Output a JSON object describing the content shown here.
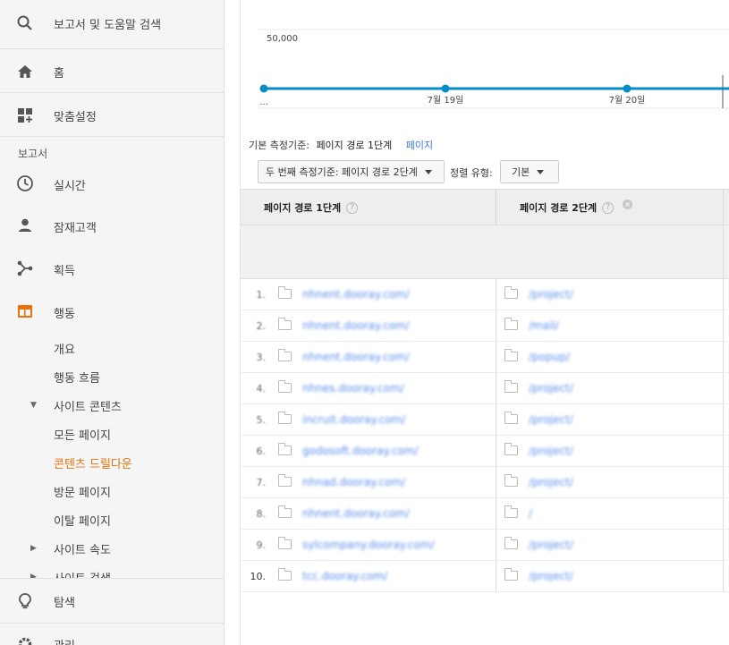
{
  "sidebar": {
    "search_label": "보고서 및 도움말 검색",
    "home_label": "홈",
    "customize_label": "맞춤설정",
    "reports_section": "보고서",
    "items": [
      {
        "label": "실시간",
        "icon": "clock-icon"
      },
      {
        "label": "잠재고객",
        "icon": "person-icon"
      },
      {
        "label": "획득",
        "icon": "acquisition-icon"
      },
      {
        "label": "행동",
        "icon": "behavior-icon"
      }
    ],
    "behavior_sub": {
      "overview": "개요",
      "flow": "행동 흐름",
      "site_content": "사이트 콘텐츠",
      "all_pages": "모든 페이지",
      "drilldown": "콘텐츠 드릴다운",
      "landing": "방문 페이지",
      "exit": "이탈 페이지",
      "site_speed": "사이트 속도",
      "site_search": "사이트 검색"
    },
    "discover_label": "탐색",
    "admin_label": "관리",
    "accent_color": "#e8710a"
  },
  "chart_data": {
    "type": "line",
    "ytick": "50,000",
    "xticks": [
      "...",
      "7월 19일",
      "7월 20일"
    ],
    "series": [
      {
        "values": [
          0,
          0,
          0,
          0,
          12000
        ]
      }
    ],
    "color": "#058dc7"
  },
  "dimension": {
    "label": "기본 측정기준:",
    "current": "페이지 경로 1단계",
    "alt": "페이지"
  },
  "controls": {
    "secondary_dim": "두 번째 측정기준: 페이지 경로 2단계",
    "sort_label": "정렬 유형:",
    "sort_value": "기본"
  },
  "table": {
    "col1": "페이지 경로 1단계",
    "col2": "페이지 경로 2단계",
    "rows": [
      {
        "num": "1.",
        "path1": "nhnent.dooray.com/",
        "path2": "/project/"
      },
      {
        "num": "2.",
        "path1": "nhnent.dooray.com/",
        "path2": "/mail/"
      },
      {
        "num": "3.",
        "path1": "nhnent.dooray.com/",
        "path2": "/popup/"
      },
      {
        "num": "4.",
        "path1": "nhnes.dooray.com/",
        "path2": "/project/"
      },
      {
        "num": "5.",
        "path1": "incruit.dooray.com/",
        "path2": "/project/"
      },
      {
        "num": "6.",
        "path1": "godosoft.dooray.com/",
        "path2": "/project/"
      },
      {
        "num": "7.",
        "path1": "nhnad.dooray.com/",
        "path2": "/project/"
      },
      {
        "num": "8.",
        "path1": "nhnent.dooray.com/",
        "path2": "/"
      },
      {
        "num": "9.",
        "path1": "sylcompany.dooray.com/",
        "path2": "/project/"
      },
      {
        "num": "10.",
        "path1": "tcc.dooray.com/",
        "path2": "/project/"
      }
    ]
  }
}
